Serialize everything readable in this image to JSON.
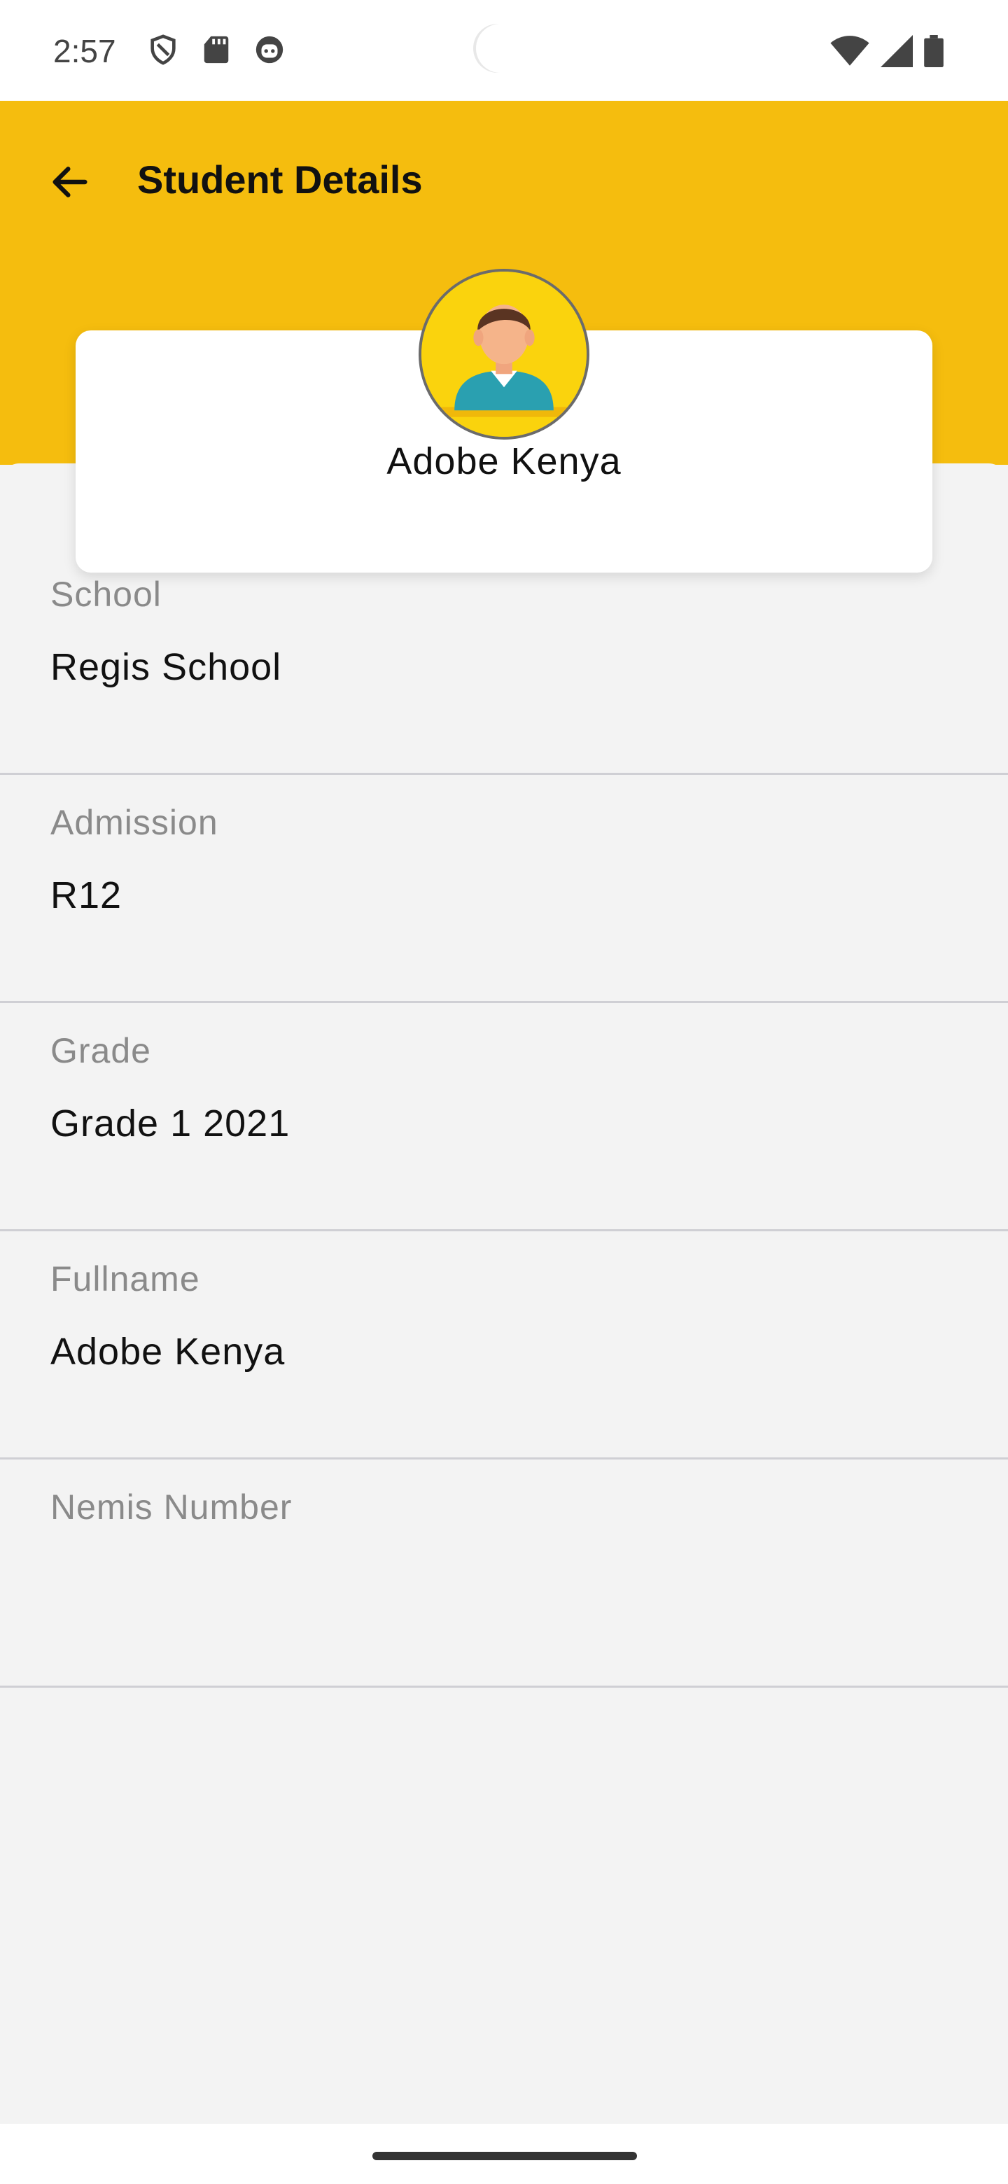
{
  "status_bar": {
    "time": "2:57",
    "left_icons": [
      "shield-icon",
      "sd-card-icon",
      "android-face-icon"
    ],
    "right_icons": [
      "wifi-icon",
      "cell-signal-icon",
      "battery-icon"
    ]
  },
  "app_bar": {
    "title": "Student Details",
    "back_icon": "arrow-left-icon",
    "color": "#f5bd0e"
  },
  "profile": {
    "name": "Adobe Kenya",
    "avatar_icon": "student-avatar-icon"
  },
  "details": [
    {
      "label": "School",
      "value": "Regis School"
    },
    {
      "label": "Admission",
      "value": "R12"
    },
    {
      "label": "Grade",
      "value": "Grade 1 2021"
    },
    {
      "label": "Fullname",
      "value": "Adobe Kenya"
    },
    {
      "label": "Nemis Number",
      "value": ""
    }
  ]
}
